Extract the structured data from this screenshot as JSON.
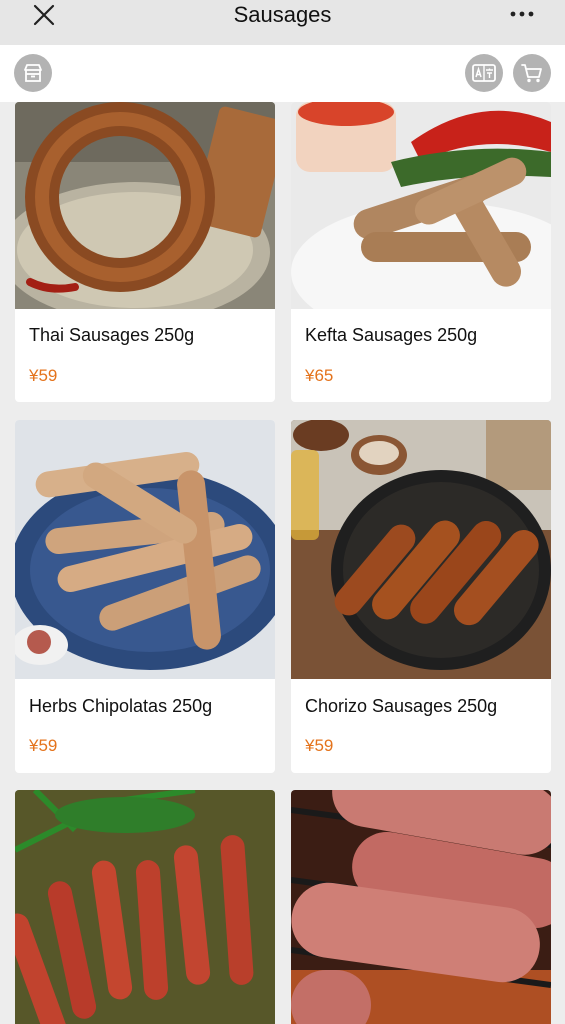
{
  "header": {
    "title": "Sausages",
    "close_icon": "close-icon",
    "more_icon": "more-dots-icon"
  },
  "toolbar": {
    "store_icon": "store-icon",
    "translate_icon": "translate-icon",
    "cart_icon": "cart-icon"
  },
  "products": [
    {
      "name": "Thai Sausages 250g",
      "price": "¥59"
    },
    {
      "name": "Kefta Sausages 250g",
      "price": "¥65"
    },
    {
      "name": "Herbs Chipolatas 250g",
      "price": "¥59"
    },
    {
      "name": "Chorizo Sausages 250g",
      "price": "¥59"
    },
    {
      "name": "",
      "price": ""
    },
    {
      "name": "",
      "price": ""
    }
  ],
  "colors": {
    "price": "#e4731c",
    "navbar": "#e6e6e6",
    "page_bg": "#ededed",
    "icon_button": "#b3b3b3"
  }
}
